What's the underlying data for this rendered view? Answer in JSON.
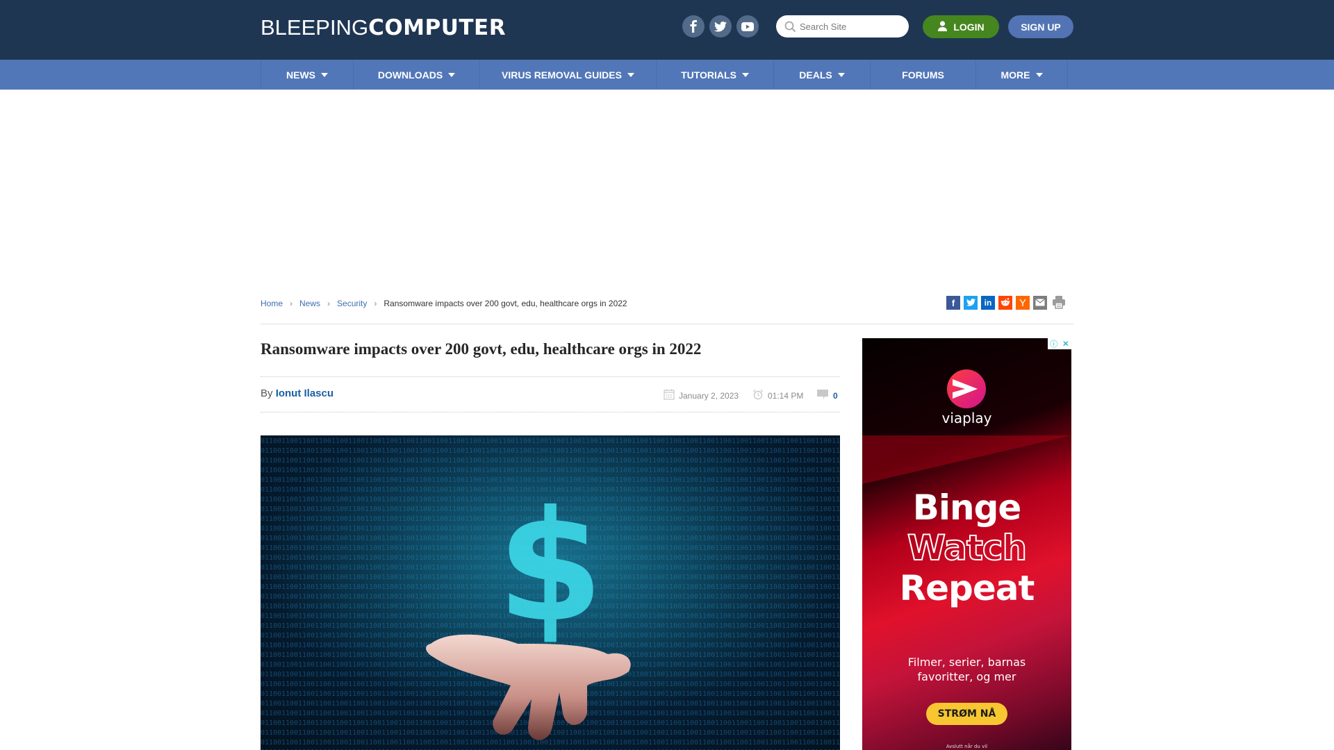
{
  "header": {
    "logo_light": "BLEEPING",
    "logo_bold": "COMPUTER",
    "social": [
      "facebook-icon",
      "twitter-icon",
      "youtube-icon"
    ],
    "search_placeholder": "Search Site",
    "login_label": "LOGIN",
    "signup_label": "SIGN UP"
  },
  "nav": {
    "items": [
      {
        "label": "NEWS",
        "dropdown": true
      },
      {
        "label": "DOWNLOADS",
        "dropdown": true
      },
      {
        "label": "VIRUS REMOVAL GUIDES",
        "dropdown": true
      },
      {
        "label": "TUTORIALS",
        "dropdown": true
      },
      {
        "label": "DEALS",
        "dropdown": true
      },
      {
        "label": "FORUMS",
        "dropdown": false
      },
      {
        "label": "MORE",
        "dropdown": true
      }
    ]
  },
  "breadcrumb": {
    "items": [
      "Home",
      "News",
      "Security"
    ],
    "current": "Ransomware impacts over 200 govt, edu, healthcare orgs in 2022"
  },
  "share": {
    "icons": [
      "facebook-share-icon",
      "twitter-share-icon",
      "linkedin-share-icon",
      "reddit-share-icon",
      "hackernews-share-icon",
      "email-share-icon",
      "print-icon"
    ],
    "colors": [
      "#3b5998",
      "#1da1f2",
      "#0a66c2",
      "#ff4500",
      "#ff6600",
      "#7d7d7d",
      "#9b9b9b"
    ]
  },
  "article": {
    "title": "Ransomware impacts over 200 govt, edu, healthcare orgs in 2022",
    "by_label": "By",
    "author": "Ionut Ilascu",
    "date": "January 2, 2023",
    "time": "01:14 PM",
    "comments": "0"
  },
  "ad": {
    "brand": "viaplay",
    "headline": [
      "Binge",
      "Watch",
      "Repeat"
    ],
    "subtext_line1": "Filmer, serier, barnas",
    "subtext_line2": "favoritter, og mer",
    "cta": "STRØM NÅ",
    "footer": "Avslutt når du vil"
  },
  "colors": {
    "header_bg": "#1f3652",
    "nav_bg": "#5277b8",
    "login_green": "#46861f",
    "signup_blue": "#5274b4",
    "link_blue": "#3f6cb3"
  }
}
